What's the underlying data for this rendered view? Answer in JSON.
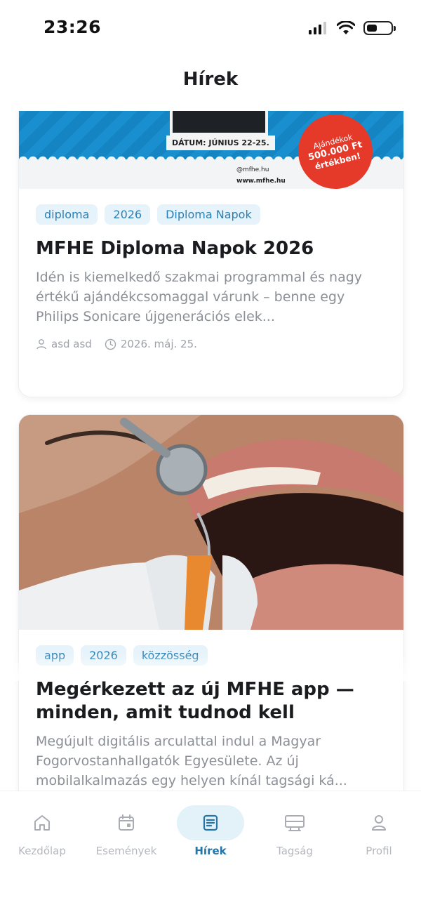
{
  "status_bar": {
    "time": "23:26",
    "battery_level": 0.45
  },
  "header": {
    "title": "Hírek"
  },
  "poster": {
    "date_text": "DÁTUM: JÚNIUS 22-25.",
    "handle": "@mfhe.hu",
    "website": "www.mfhe.hu",
    "badge": {
      "line1": "Ajándékok",
      "line2": "500.000 Ft",
      "line3": "értékben!"
    },
    "badge_color": "#e53a2a"
  },
  "articles": [
    {
      "tags": [
        "diploma",
        "2026",
        "Diploma Napok"
      ],
      "title": "MFHE Diploma Napok 2026",
      "excerpt": "Idén is kiemelkedő szakmai programmal és nagy értékű ajándékcsomaggal várunk – benne egy Philips Sonicare újgenerációs elek...",
      "author": "asd asd",
      "date": "2026. máj. 25."
    },
    {
      "tags": [
        "app",
        "2026",
        "közzösség"
      ],
      "title": "Megérkezett az új MFHE app — minden, amit tudnod kell",
      "excerpt": "Megújult digitális arculattal indul a Magyar Fogorvostanhallgatók Egyesülete. Az új mobilalkalmazás egy helyen kínál tagsági ká..."
    }
  ],
  "nav": [
    {
      "label": "Kezdőlap",
      "icon": "home-icon"
    },
    {
      "label": "Események",
      "icon": "calendar-icon"
    },
    {
      "label": "Hírek",
      "icon": "news-icon",
      "active": true
    },
    {
      "label": "Tagság",
      "icon": "membership-card-icon"
    },
    {
      "label": "Profil",
      "icon": "user-icon"
    }
  ],
  "colors": {
    "accent": "#2475a8",
    "tag_bg": "#e6f3fa",
    "tag_text": "#2a7fb5",
    "active_nav_bg": "#e3f1f8"
  }
}
